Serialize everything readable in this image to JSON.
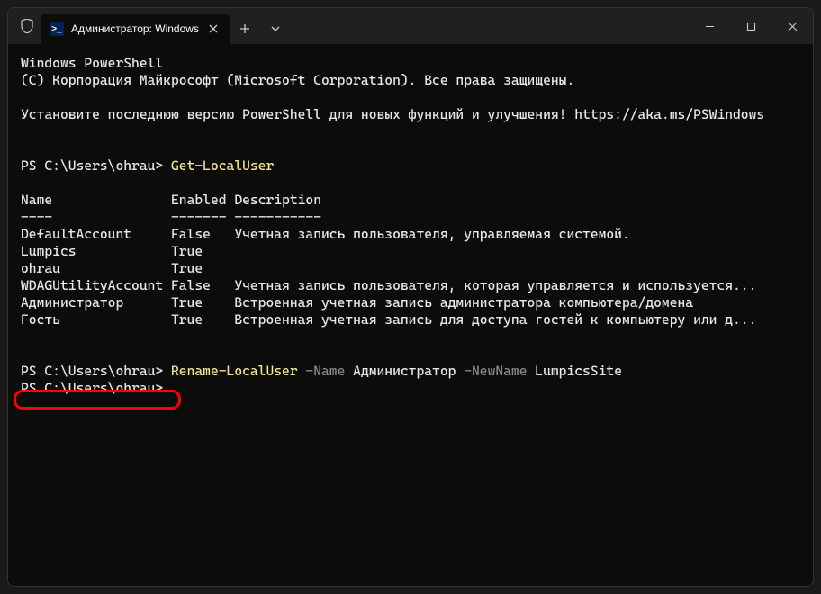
{
  "titlebar": {
    "tab_title": "Администратор: Windows Po"
  },
  "terminal": {
    "header1": "Windows PowerShell",
    "header2": "(С) Корпорация Майкрософт (Microsoft Corporation). Все права защищены.",
    "install_msg": "Установите последнюю версию PowerShell для новых функций и улучшения! https://aka.ms/PSWindows",
    "prompt1": "PS C:\\Users\\ohrau> ",
    "cmd1": "Get-LocalUser",
    "col_name": "Name",
    "col_enabled": "Enabled",
    "col_desc": "Description",
    "sep1": "----",
    "sep2": "-------",
    "sep3": "-----------",
    "rows": [
      {
        "name": "DefaultAccount    ",
        "enabled": " False  ",
        "desc": " Учетная запись пользователя, управляемая системой."
      },
      {
        "name": "Lumpics           ",
        "enabled": " True",
        "desc": ""
      },
      {
        "name": "ohrau             ",
        "enabled": " True",
        "desc": ""
      },
      {
        "name": "WDAGUtilityAccount",
        "enabled": " False  ",
        "desc": " Учетная запись пользователя, которая управляется и используется..."
      },
      {
        "name": "Администратор     ",
        "enabled": " True   ",
        "desc": " Встроенная учетная запись администратора компьютера/домена"
      },
      {
        "name": "Гость             ",
        "enabled": " True   ",
        "desc": " Встроенная учетная запись для доступа гостей к компьютеру или д..."
      }
    ],
    "prompt2": "PS C:\\Users\\ohrau> ",
    "cmd2": "Rename-LocalUser",
    "flag_name": " -Name",
    "arg_name": " Администратор",
    "flag_newname": " -NewName",
    "arg_newname": " LumpicsSite",
    "prompt3": "PS C:\\Users\\ohrau>"
  }
}
